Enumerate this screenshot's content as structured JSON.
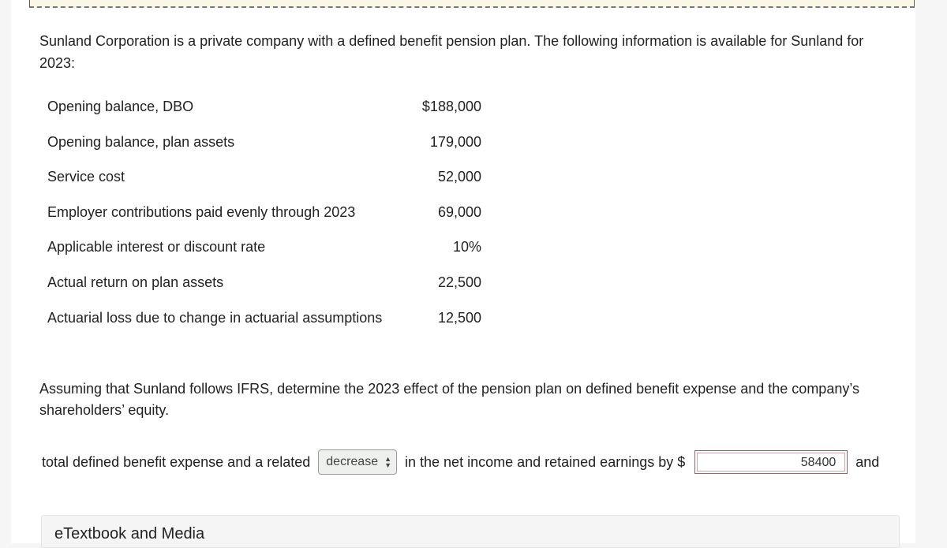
{
  "intro": "Sunland Corporation is a private company with a defined benefit pension plan. The following information is available for Sunland for 2023:",
  "items": [
    {
      "label": "Opening balance, DBO",
      "value": "$188,000"
    },
    {
      "label": "Opening balance, plan assets",
      "value": "179,000"
    },
    {
      "label": "Service cost",
      "value": "52,000"
    },
    {
      "label": "Employer contributions paid evenly through 2023",
      "value": "69,000"
    },
    {
      "label": "Applicable interest or discount rate",
      "value": "10%"
    },
    {
      "label": "Actual return on plan assets",
      "value": "22,500"
    },
    {
      "label": "Actuarial loss due to change in actuarial assumptions",
      "value": "12,500"
    }
  ],
  "question": "Assuming that Sunland follows IFRS, determine the 2023 effect of the pension plan on defined benefit expense and the company’s shareholders’ equity.",
  "answer": {
    "prefix": "total defined benefit expense and a related",
    "select_value": "decrease",
    "middle": "in the net income and retained earnings by $",
    "input_value": "58400",
    "suffix": "and"
  },
  "etextbook_label": "eTextbook and Media"
}
